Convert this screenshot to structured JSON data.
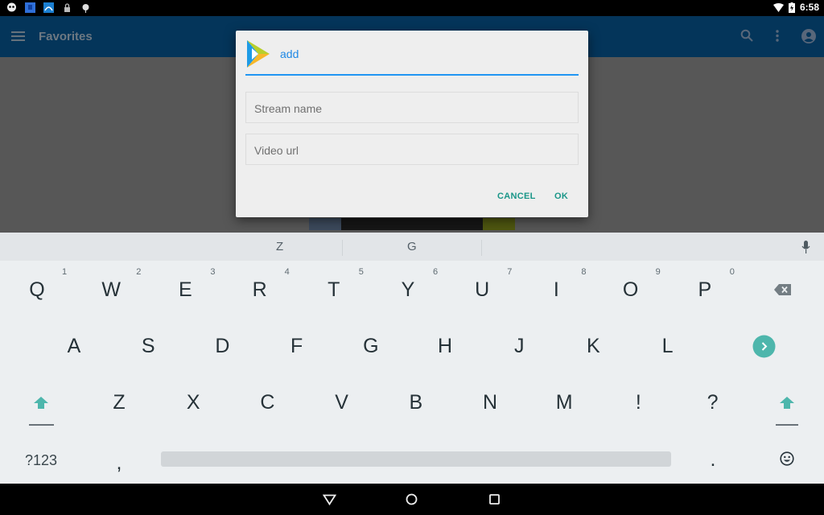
{
  "status_bar": {
    "left_icons": [
      "ghost-notification-icon",
      "blue-app-notification-icon",
      "wave-app-notification-icon",
      "lock-icon",
      "android-debug-icon"
    ],
    "right_icons": [
      "wifi-icon",
      "battery-charging-icon"
    ],
    "time": "6:58"
  },
  "app_bar": {
    "title": "Favorites",
    "icons": [
      "menu-icon",
      "search-icon",
      "more-vert-icon",
      "account-icon"
    ],
    "color": "#04355a"
  },
  "dialog": {
    "title": "add",
    "title_color": "#1e88e5",
    "fields": [
      {
        "placeholder": "Stream name",
        "value": ""
      },
      {
        "placeholder": "Video url",
        "value": ""
      }
    ],
    "buttons": {
      "cancel": "CANCEL",
      "ok": "OK"
    },
    "button_color": "#1a9688"
  },
  "keyboard": {
    "suggestions": [
      "Z",
      "G"
    ],
    "row1": [
      {
        "key": "Q",
        "hint": "1"
      },
      {
        "key": "W",
        "hint": "2"
      },
      {
        "key": "E",
        "hint": "3"
      },
      {
        "key": "R",
        "hint": "4"
      },
      {
        "key": "T",
        "hint": "5"
      },
      {
        "key": "Y",
        "hint": "6"
      },
      {
        "key": "U",
        "hint": "7"
      },
      {
        "key": "I",
        "hint": "8"
      },
      {
        "key": "O",
        "hint": "9"
      },
      {
        "key": "P",
        "hint": "0"
      }
    ],
    "row2": [
      "A",
      "S",
      "D",
      "F",
      "G",
      "H",
      "J",
      "K",
      "L"
    ],
    "row3": [
      "Z",
      "X",
      "C",
      "V",
      "B",
      "N",
      "M",
      "!",
      "?"
    ],
    "row4": {
      "symbols": "?123",
      "comma": ",",
      "period": "."
    },
    "accent": "#4db6ac"
  },
  "nav_bar": {
    "icons": [
      "back-icon",
      "home-icon",
      "recents-icon"
    ]
  }
}
